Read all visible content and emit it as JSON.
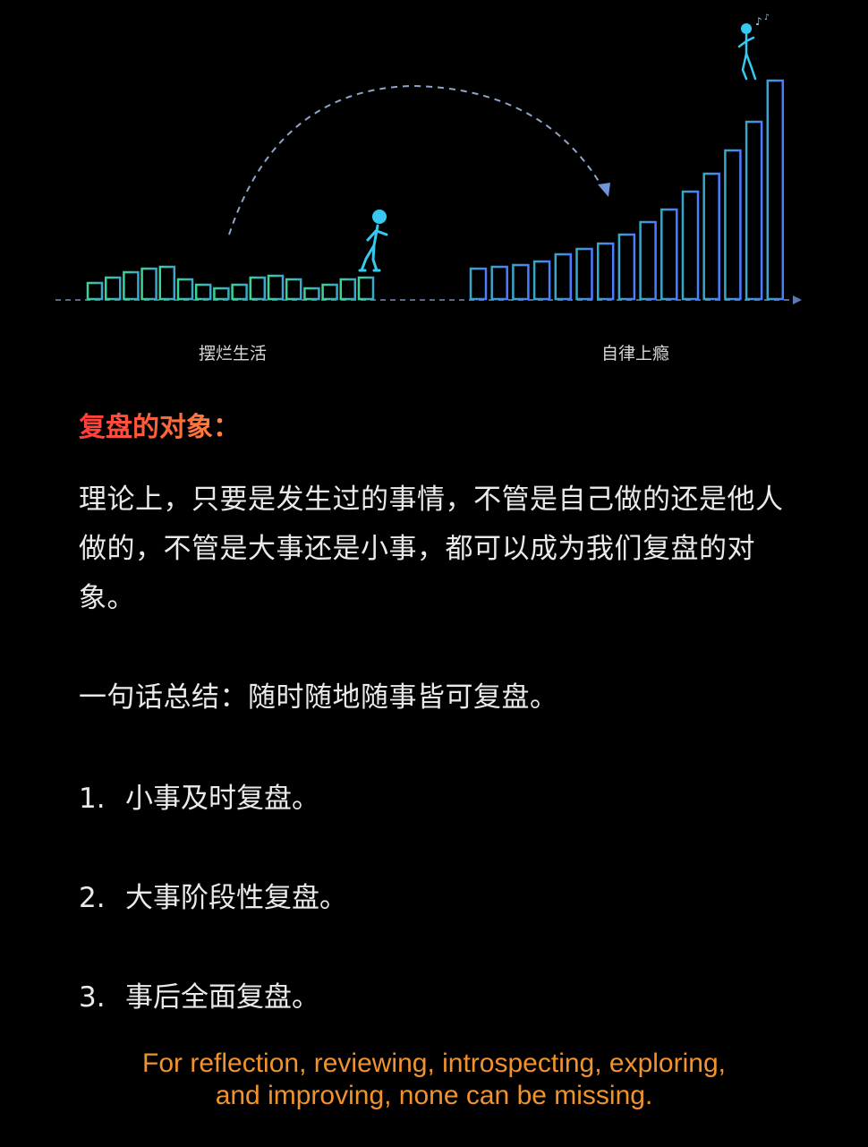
{
  "illustration": {
    "left_label": "摆烂生活",
    "right_label": "自律上瘾",
    "left_color": "#3bd6a6",
    "right_color": "#4a86ff",
    "figure_color": "#37c8f0",
    "arc_color": "#8fa6c8"
  },
  "section": {
    "heading": "复盘的对象：",
    "intro": "理论上，只要是发生过的事情，不管是自己做的还是他人做的，不管是大事还是小事，都可以成为我们复盘的对象。",
    "summary": "一句话总结：随时随地随事皆可复盘。",
    "items": [
      {
        "num": "1.",
        "text": "小事及时复盘。"
      },
      {
        "num": "2.",
        "text": "大事阶段性复盘。"
      },
      {
        "num": "3.",
        "text": "事后全面复盘。"
      }
    ]
  },
  "footer": {
    "line1": "For reflection, reviewing, introspecting, exploring,",
    "line2": "and improving, none can be missing."
  }
}
